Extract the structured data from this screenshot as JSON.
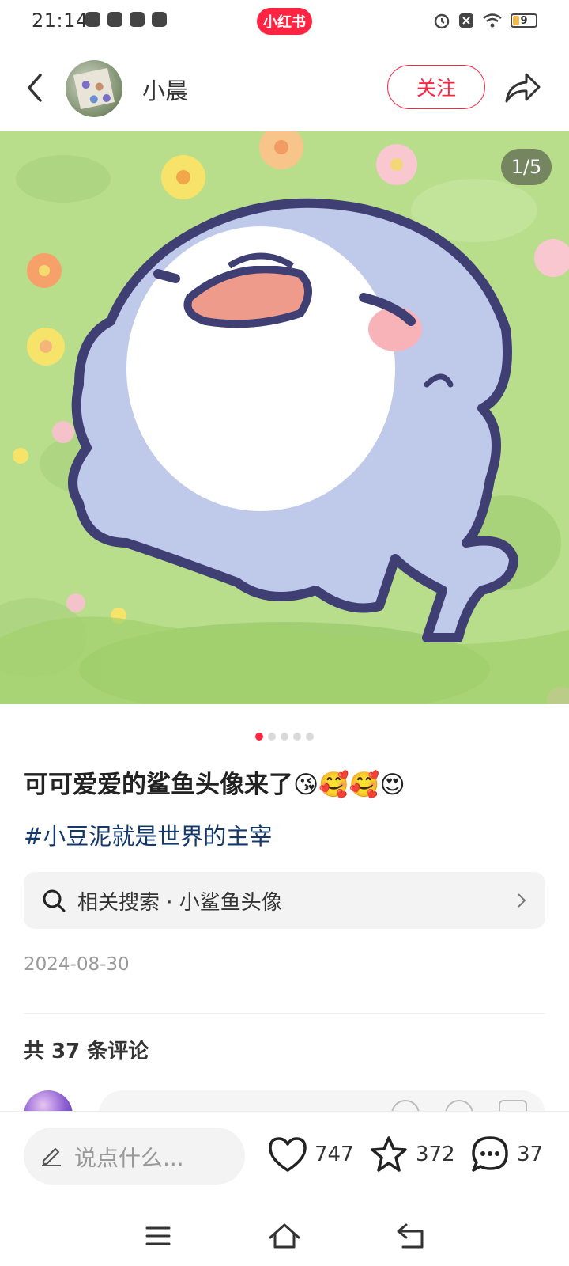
{
  "status_bar": {
    "time": "21:14",
    "app_badge": "小红书",
    "battery_level": "9"
  },
  "header": {
    "username": "小晨",
    "follow_label": "关注"
  },
  "media": {
    "page_indicator": "1/5",
    "total_pages": 5,
    "current_page": 1
  },
  "post": {
    "title": "可可爱爱的鲨鱼头像来了😘🥰🥰😍",
    "hashtag": "#小豆泥就是世界的主宰",
    "related_search": "相关搜索 · 小鲨鱼头像",
    "date": "2024-08-30",
    "comments_header": "共 37 条评论"
  },
  "bottom_bar": {
    "comment_placeholder": "说点什么...",
    "likes": "747",
    "favorites": "372",
    "comments": "37"
  },
  "colors": {
    "brand": "#ff2442",
    "hashtag": "#13386c",
    "grass": "#b8de8c",
    "shark_body": "#bfc9ea",
    "shark_outline": "#3f3f74"
  }
}
